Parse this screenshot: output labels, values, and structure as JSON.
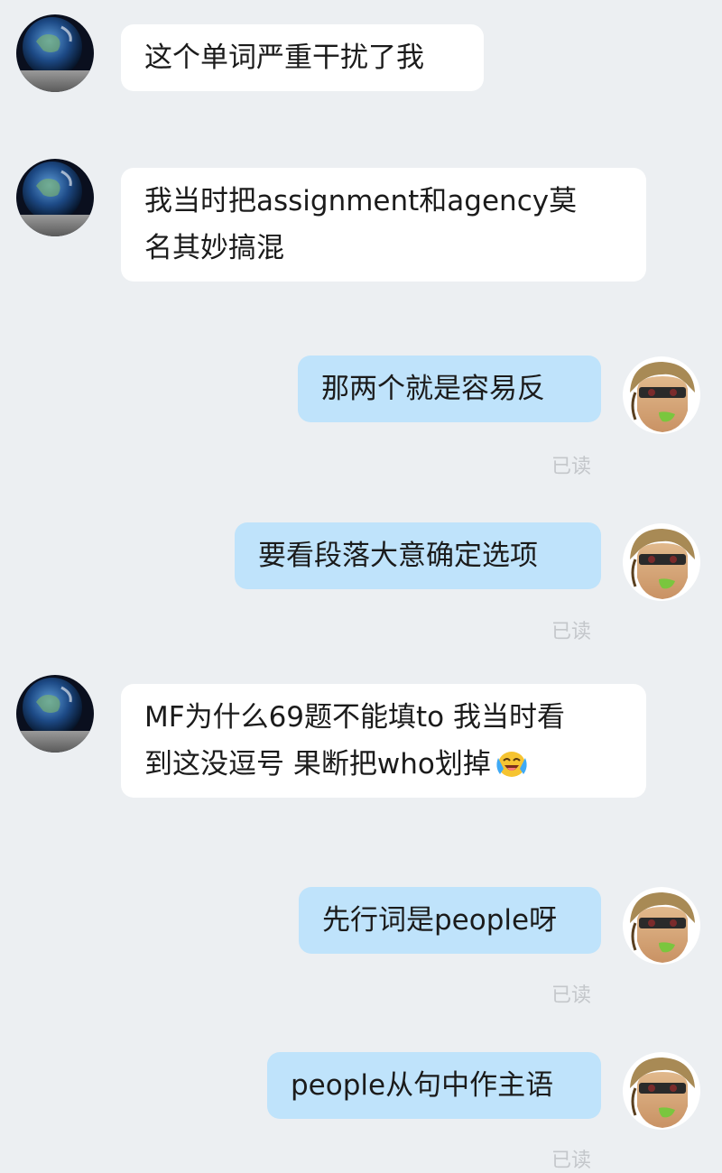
{
  "messages": [
    {
      "side": "recv",
      "lines": [
        "这个单词严重干扰了我"
      ]
    },
    {
      "side": "recv",
      "lines": [
        "我当时把assignment和agency莫",
        "名其妙搞混"
      ]
    },
    {
      "side": "sent",
      "lines": [
        "那两个就是容易反"
      ],
      "status": "已读"
    },
    {
      "side": "sent",
      "lines": [
        "要看段落大意确定选项"
      ],
      "status": "已读"
    },
    {
      "side": "recv",
      "lines": [
        "MF为什么69题不能填to 我当时看",
        "到这没逗号  果断把who划掉"
      ],
      "emoji": "crying-laughing-face-icon"
    },
    {
      "side": "sent",
      "lines": [
        "先行词是people呀"
      ],
      "status": "已读"
    },
    {
      "side": "sent",
      "lines": [
        "people从句中作主语"
      ],
      "status": "已读"
    }
  ],
  "avatars": {
    "received": "earth-avatar-icon",
    "sent": "anime-character-avatar-icon"
  },
  "colors": {
    "background": "#eceff2",
    "received_bubble": "#ffffff",
    "sent_bubble": "#bfe3fb",
    "read_status": "#c4c7cb"
  }
}
